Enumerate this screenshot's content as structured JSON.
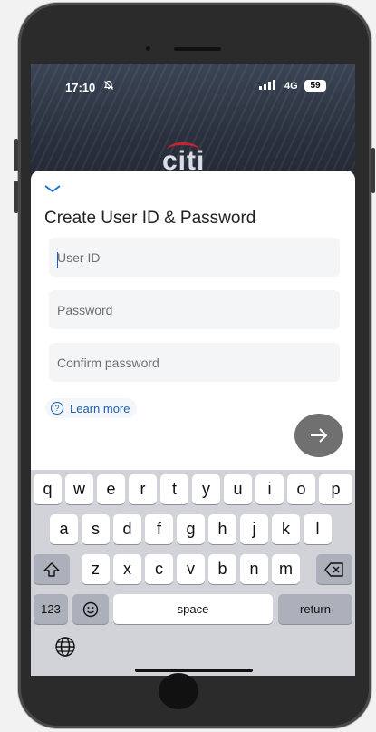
{
  "status_bar": {
    "time": "17:10",
    "network": "4G",
    "battery": "59"
  },
  "brand": {
    "logo_text": "citi",
    "accent": "#d0202e"
  },
  "sheet": {
    "title": "Create User ID & Password",
    "user_id_placeholder": "User ID",
    "password_placeholder": "Password",
    "confirm_placeholder": "Confirm password",
    "learn_more_label": "Learn more",
    "next_icon": "arrow-right-icon"
  },
  "keyboard": {
    "row1": [
      "q",
      "w",
      "e",
      "r",
      "t",
      "y",
      "u",
      "i",
      "o",
      "p"
    ],
    "row2": [
      "a",
      "s",
      "d",
      "f",
      "g",
      "h",
      "j",
      "k",
      "l"
    ],
    "row3": [
      "z",
      "x",
      "c",
      "v",
      "b",
      "n",
      "m"
    ],
    "num_label": "123",
    "space_label": "space",
    "return_label": "return"
  }
}
